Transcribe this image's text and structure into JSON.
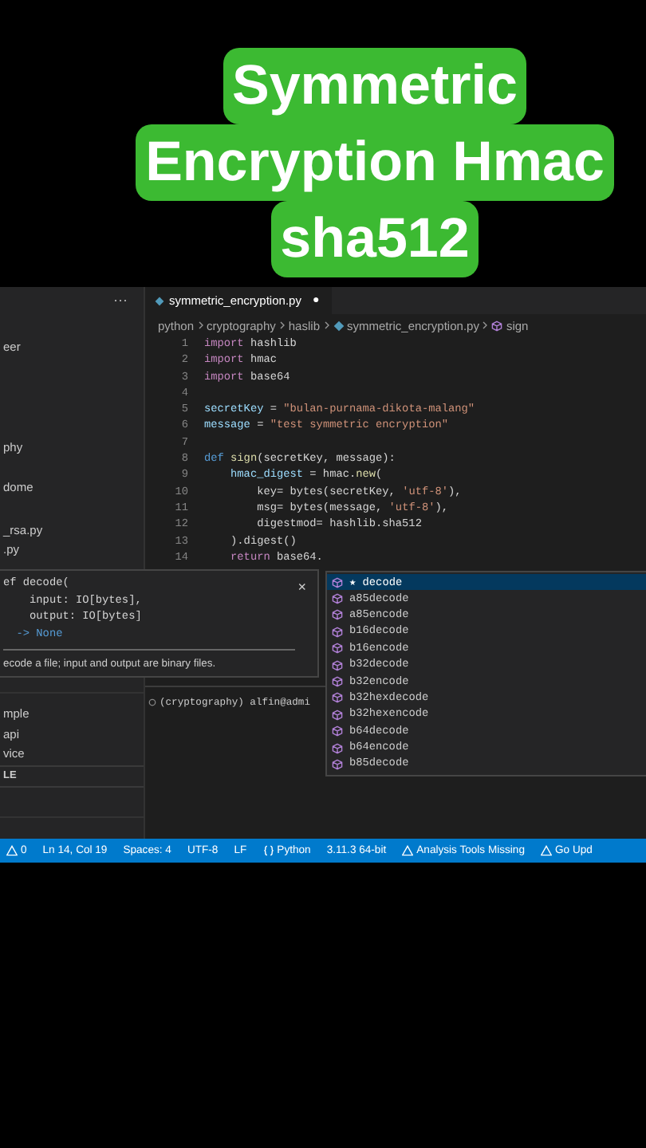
{
  "title_lines": [
    "Symmetric",
    "Encryption Hmac",
    "sha512"
  ],
  "sidebar": {
    "more": "···",
    "items": [
      "eer",
      "phy",
      "dome",
      "_rsa.py",
      ".py"
    ],
    "lower_items": [
      "mple",
      "api",
      "vice"
    ],
    "section": "LE"
  },
  "tab": {
    "label": "symmetric_encryption.py",
    "dirty": true,
    "dot": "●"
  },
  "breadcrumbs": [
    {
      "kind": "folder",
      "text": "python"
    },
    {
      "kind": "folder",
      "text": "cryptography"
    },
    {
      "kind": "folder",
      "text": "haslib"
    },
    {
      "kind": "file",
      "text": "symmetric_encryption.py"
    },
    {
      "kind": "symbol",
      "text": "sign"
    }
  ],
  "code": [
    {
      "n": "1",
      "tokens": [
        {
          "kind": "keyword",
          "text": "import"
        },
        {
          "kind": "plain",
          "text": " hashlib"
        }
      ]
    },
    {
      "n": "2",
      "tokens": [
        {
          "kind": "keyword",
          "text": "import"
        },
        {
          "kind": "plain",
          "text": " hmac"
        }
      ]
    },
    {
      "n": "3",
      "tokens": [
        {
          "kind": "keyword",
          "text": "import"
        },
        {
          "kind": "plain",
          "text": " base64"
        }
      ]
    },
    {
      "n": "4"
    },
    {
      "n": "5",
      "tokens": [
        {
          "kind": "variable",
          "text": "secretKey"
        },
        {
          "kind": "plain",
          "text": " = "
        },
        {
          "kind": "string",
          "text": "\"bulan-purnama-dikota-malang\""
        }
      ]
    },
    {
      "n": "6",
      "tokens": [
        {
          "kind": "variable",
          "text": "message"
        },
        {
          "kind": "plain",
          "text": " = "
        },
        {
          "kind": "string",
          "text": "\"test symmetric encryption\""
        }
      ]
    },
    {
      "n": "7"
    },
    {
      "n": "8",
      "tokens": [
        {
          "kind": "storage",
          "text": "def"
        },
        {
          "kind": "function",
          "text": " sign"
        },
        {
          "kind": "plain",
          "text": "(secretKey, message):"
        }
      ]
    },
    {
      "n": "9",
      "tokens": [
        {
          "kind": "variable",
          "text": "    hmac_digest"
        },
        {
          "kind": "plain",
          "text": " = hmac."
        },
        {
          "kind": "function",
          "text": "new"
        },
        {
          "kind": "plain",
          "text": "("
        }
      ]
    },
    {
      "n": "10",
      "tokens": [
        {
          "kind": "plain",
          "text": "        key= bytes(secretKey, "
        },
        {
          "kind": "string",
          "text": "'utf-8'"
        },
        {
          "kind": "plain",
          "text": "),"
        }
      ]
    },
    {
      "n": "11",
      "tokens": [
        {
          "kind": "plain",
          "text": "        msg= bytes(message, "
        },
        {
          "kind": "string",
          "text": "'utf-8'"
        },
        {
          "kind": "plain",
          "text": "),"
        }
      ]
    },
    {
      "n": "12",
      "tokens": [
        {
          "kind": "plain",
          "text": "        digestmod= hashlib.sha512"
        }
      ]
    },
    {
      "n": "13",
      "tokens": [
        {
          "kind": "plain",
          "text": "    ).digest()"
        }
      ]
    },
    {
      "n": "14",
      "tokens": [
        {
          "kind": "keyword",
          "text": "    return"
        },
        {
          "kind": "plain",
          "text": " base64."
        }
      ]
    }
  ],
  "hover": {
    "signature": [
      "ef decode(",
      "    input: IO[bytes],",
      "    output: IO[bytes]",
      "  -> None"
    ],
    "close": "×",
    "doc": "ecode a file; input and output are binary files."
  },
  "suggestions": [
    {
      "label": "★ decode",
      "selected": true
    },
    {
      "label": "a85decode",
      "selected": false
    },
    {
      "label": "a85encode",
      "selected": false
    },
    {
      "label": "b16decode",
      "selected": false
    },
    {
      "label": "b16encode",
      "selected": false
    },
    {
      "label": "b32decode",
      "selected": false
    },
    {
      "label": "b32encode",
      "selected": false
    },
    {
      "label": "b32hexdecode",
      "selected": false
    },
    {
      "label": "b32hexencode",
      "selected": false
    },
    {
      "label": "b64decode",
      "selected": false
    },
    {
      "label": "b64encode",
      "selected": false
    },
    {
      "label": "b85decode",
      "selected": false
    }
  ],
  "terminal": {
    "prompt": "(cryptography) alfin@admi"
  },
  "status_bar": [
    {
      "kind": "warning",
      "text": "0"
    },
    {
      "kind": "text",
      "text": "Ln 14, Col 19"
    },
    {
      "kind": "text",
      "text": "Spaces: 4"
    },
    {
      "kind": "text",
      "text": "UTF-8"
    },
    {
      "kind": "text",
      "text": "LF"
    },
    {
      "kind": "braces",
      "text": "Python"
    },
    {
      "kind": "text",
      "text": "3.11.3 64-bit"
    },
    {
      "kind": "warning",
      "text": "Analysis Tools Missing"
    },
    {
      "kind": "warning",
      "text": "Go Upd"
    }
  ]
}
